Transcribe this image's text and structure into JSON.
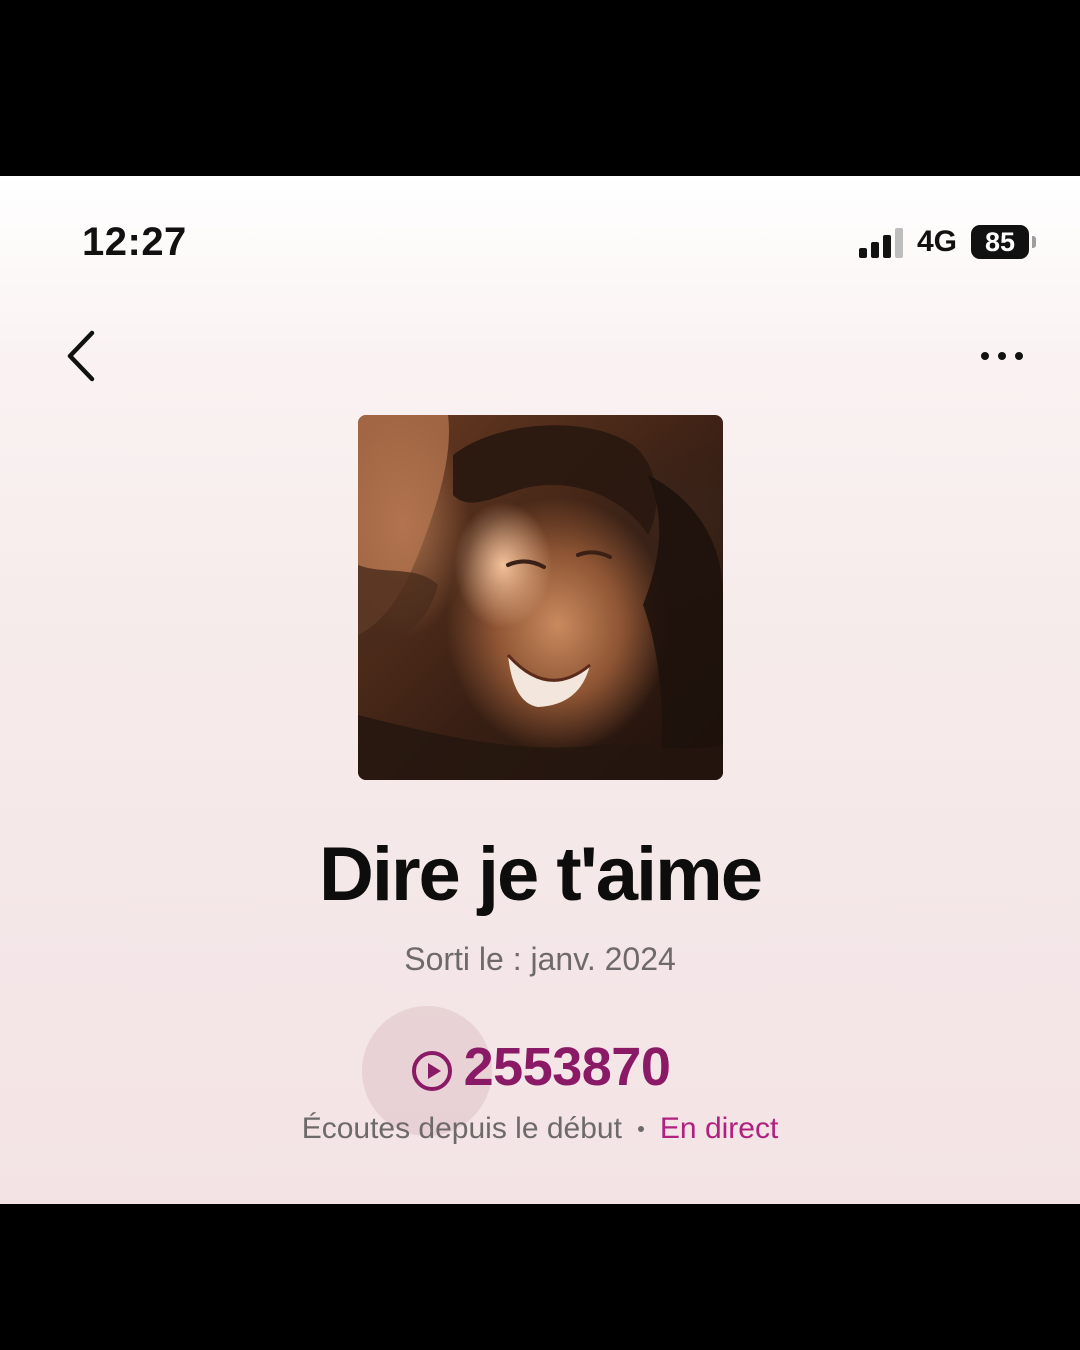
{
  "status_bar": {
    "time": "12:27",
    "network": "4G",
    "battery": "85",
    "signal_bars_active": 3,
    "signal_bars_total": 4
  },
  "nav": {
    "back_icon": "chevron-left-icon",
    "more_icon": "more-horizontal-icon"
  },
  "track": {
    "title": "Dire je t'aime",
    "release": "Sorti le : janv. 2024",
    "play_count": "2553870",
    "plays_caption": "Écoutes depuis le début",
    "live_label": "En direct"
  },
  "colors": {
    "accent": "#8b1a66",
    "live": "#b0207e",
    "text_primary": "#0d0d0d",
    "text_secondary": "#6e6a6b"
  }
}
